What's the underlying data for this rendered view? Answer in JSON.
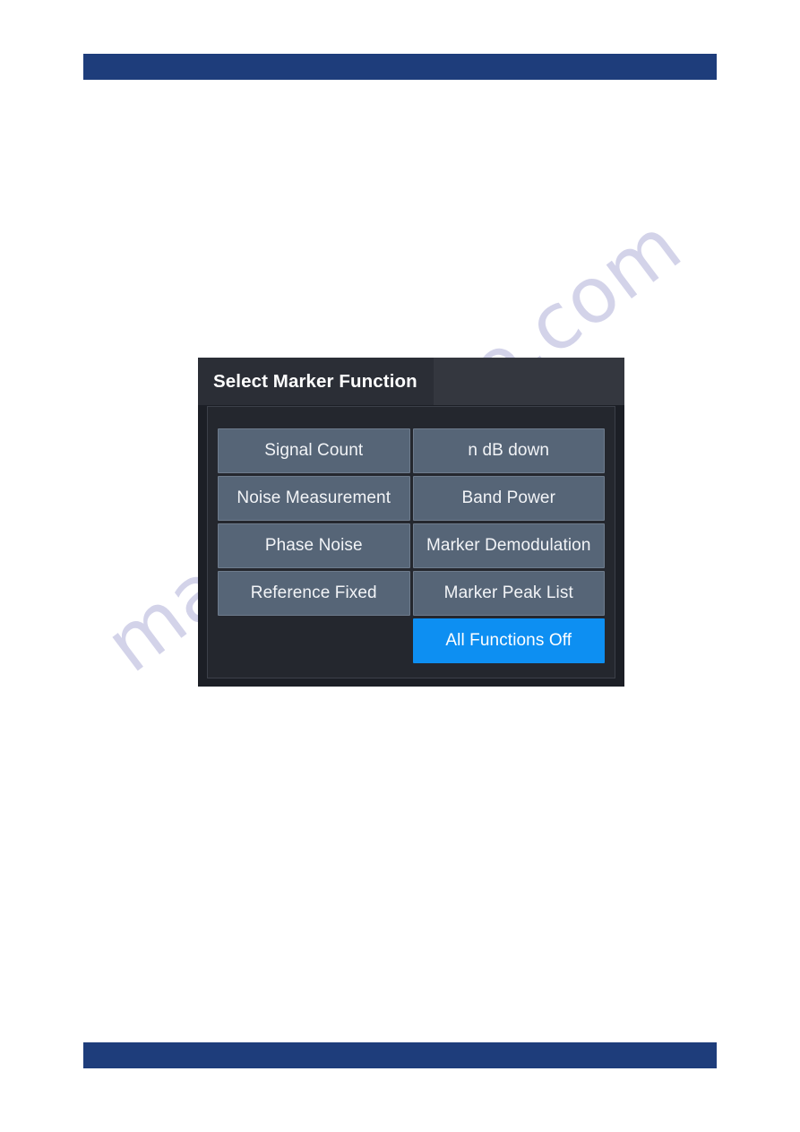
{
  "page": {
    "background_color": "#ffffff",
    "banner_color": "#1e3d7b",
    "watermark_text": "manualshive.com"
  },
  "dialog": {
    "title": "Select Marker Function",
    "background_color": "#1c1f26",
    "panel_color": "#24272e",
    "button_color": "#566577",
    "accent_color": "#0d8ff2",
    "buttons": [
      {
        "label": "Signal Count",
        "style": "normal",
        "name": "signal-count-button"
      },
      {
        "label": "n dB down",
        "style": "normal",
        "name": "n-db-down-button"
      },
      {
        "label": "Noise Measurement",
        "style": "normal",
        "name": "noise-measurement-button"
      },
      {
        "label": "Band Power",
        "style": "normal",
        "name": "band-power-button"
      },
      {
        "label": "Phase Noise",
        "style": "normal",
        "name": "phase-noise-button"
      },
      {
        "label": "Marker Demodulation",
        "style": "normal",
        "name": "marker-demodulation-button"
      },
      {
        "label": "Reference Fixed",
        "style": "normal",
        "name": "reference-fixed-button"
      },
      {
        "label": "Marker Peak List",
        "style": "normal",
        "name": "marker-peak-list-button"
      },
      {
        "label": "",
        "style": "empty",
        "name": "empty-cell"
      },
      {
        "label": "All Functions Off",
        "style": "accent",
        "name": "all-functions-off-button"
      }
    ]
  }
}
